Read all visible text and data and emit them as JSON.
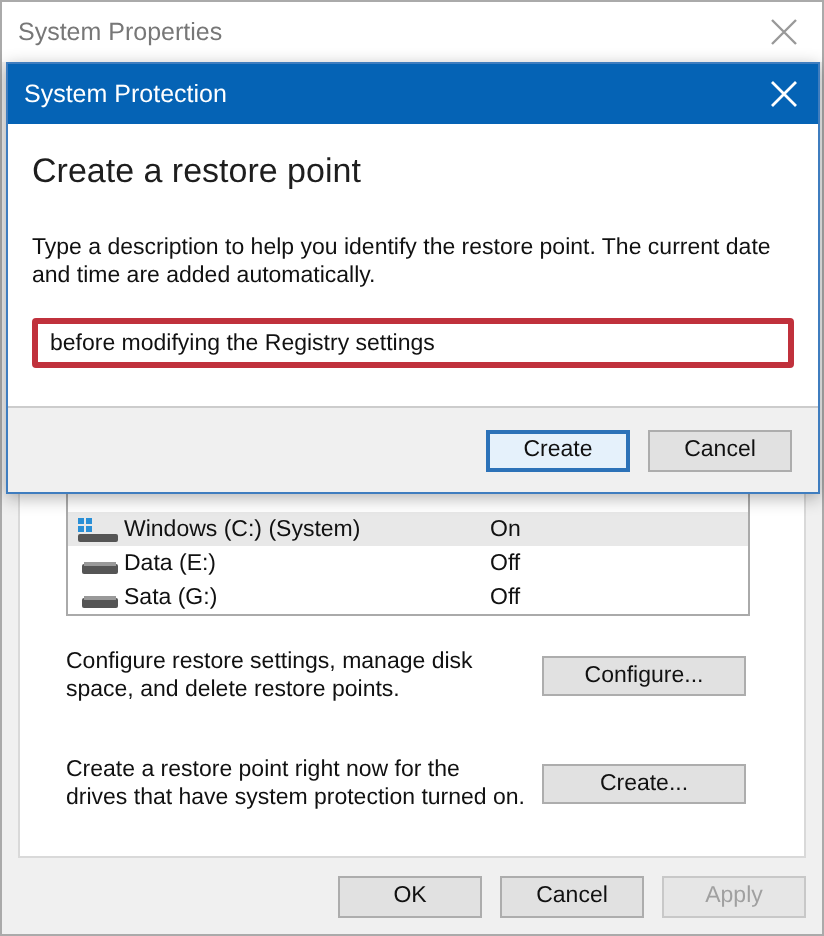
{
  "window": {
    "title": "System Properties"
  },
  "drives": [
    {
      "name": "Windows (C:) (System)",
      "protection": "On",
      "kind": "system",
      "selected": true
    },
    {
      "name": "Data (E:)",
      "protection": "Off",
      "kind": "plain",
      "selected": false
    },
    {
      "name": "Sata (G:)",
      "protection": "Off",
      "kind": "plain",
      "selected": false
    }
  ],
  "actions": [
    {
      "text": "Configure restore settings, manage disk space, and delete restore points.",
      "button": "Configure..."
    },
    {
      "text": "Create a restore point right now for the drives that have system protection turned on.",
      "button": "Create..."
    }
  ],
  "footer_buttons": [
    {
      "label": "OK",
      "disabled": false
    },
    {
      "label": "Cancel",
      "disabled": false
    },
    {
      "label": "Apply",
      "disabled": true
    }
  ],
  "dialog": {
    "title": "System Protection",
    "heading": "Create a restore point",
    "description": "Type a description to help you identify the restore point. The current date and time are added automatically.",
    "field": {
      "value": "before modifying the Registry settings",
      "highlighted": true
    },
    "buttons": [
      {
        "label": "Create",
        "default": true
      },
      {
        "label": "Cancel",
        "default": false
      }
    ]
  }
}
